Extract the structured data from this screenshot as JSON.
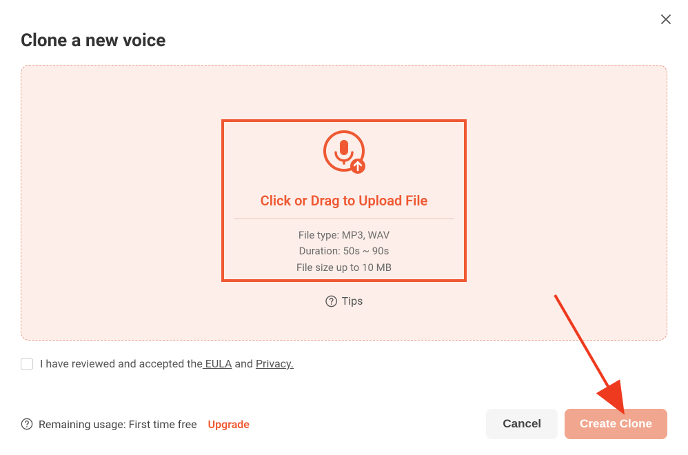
{
  "modal": {
    "title": "Clone a new voice",
    "upload": {
      "cta": "Click or Drag to Upload File",
      "file_type": "File type: MP3, WAV",
      "duration": "Duration: 50s ~ 90s",
      "size": "File size up to 10 MB"
    },
    "tips_label": "Tips"
  },
  "consent": {
    "prefix": "I have reviewed and accepted the",
    "eula": " EULA",
    "mid": " and ",
    "privacy": "Privacy."
  },
  "footer": {
    "usage_label": "Remaining usage: First time free",
    "upgrade": "Upgrade",
    "cancel": "Cancel",
    "create": "Create Clone"
  },
  "colors": {
    "accent": "#ee5933",
    "accent_light": "#f1a68f",
    "bg_tint": "#fdeee9"
  }
}
